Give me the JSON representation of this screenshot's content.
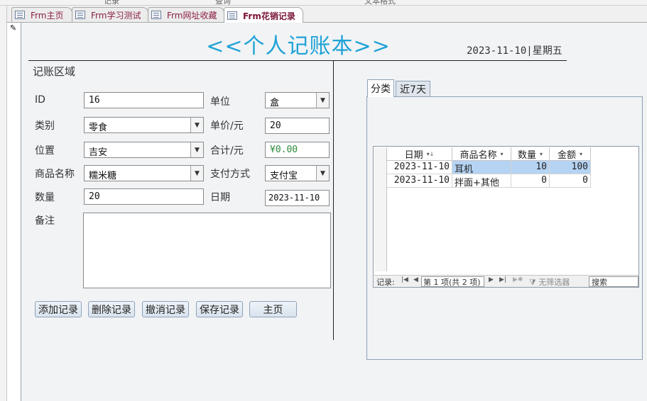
{
  "top_strip": {
    "left_text": "记录",
    "mid_text": "查询",
    "right_text": "文本格式"
  },
  "tabs": [
    {
      "label": "Frm主页"
    },
    {
      "label": "Frm学习测试"
    },
    {
      "label": "Frm网址收藏"
    },
    {
      "label": "Frm花销记录"
    }
  ],
  "header": {
    "title": "<<个人记账本>>",
    "date_weekday": "2023-11-10|星期五"
  },
  "form": {
    "section_label": "记账区域",
    "fields": {
      "id": {
        "label": "ID",
        "value": "16"
      },
      "category": {
        "label": "类别",
        "value": "零食"
      },
      "location": {
        "label": "位置",
        "value": "吉安"
      },
      "product": {
        "label": "商品名称",
        "value": "糯米糖"
      },
      "quantity": {
        "label": "数量",
        "value": "20"
      },
      "unit": {
        "label": "单位",
        "value": "盒"
      },
      "unit_price": {
        "label": "单价/元",
        "value": "20"
      },
      "total": {
        "label": "合计/元",
        "value": "¥0.00"
      },
      "payment": {
        "label": "支付方式",
        "value": "支付宝"
      },
      "date": {
        "label": "日期",
        "value": "2023-11-10"
      },
      "note": {
        "label": "备注",
        "value": ""
      }
    },
    "buttons": {
      "add": "添加记录",
      "delete": "删除记录",
      "undo": "撤消记录",
      "save": "保存记录",
      "home": "主页"
    }
  },
  "tab_control": {
    "tabs": [
      "分类",
      "近7天"
    ],
    "datasheet": {
      "columns": [
        "日期",
        "商品名称",
        "数量",
        "金额"
      ],
      "rows": [
        {
          "date": "2023-11-10",
          "name": "耳机",
          "qty": "10",
          "amount": "100"
        },
        {
          "date": "2023-11-10",
          "name": "拌面+其他",
          "qty": "0",
          "amount": "0"
        }
      ],
      "nav": {
        "label": "记录:",
        "position": "第 1 项(共 2 项)",
        "filter": "无筛选器",
        "search": "搜索"
      }
    }
  }
}
